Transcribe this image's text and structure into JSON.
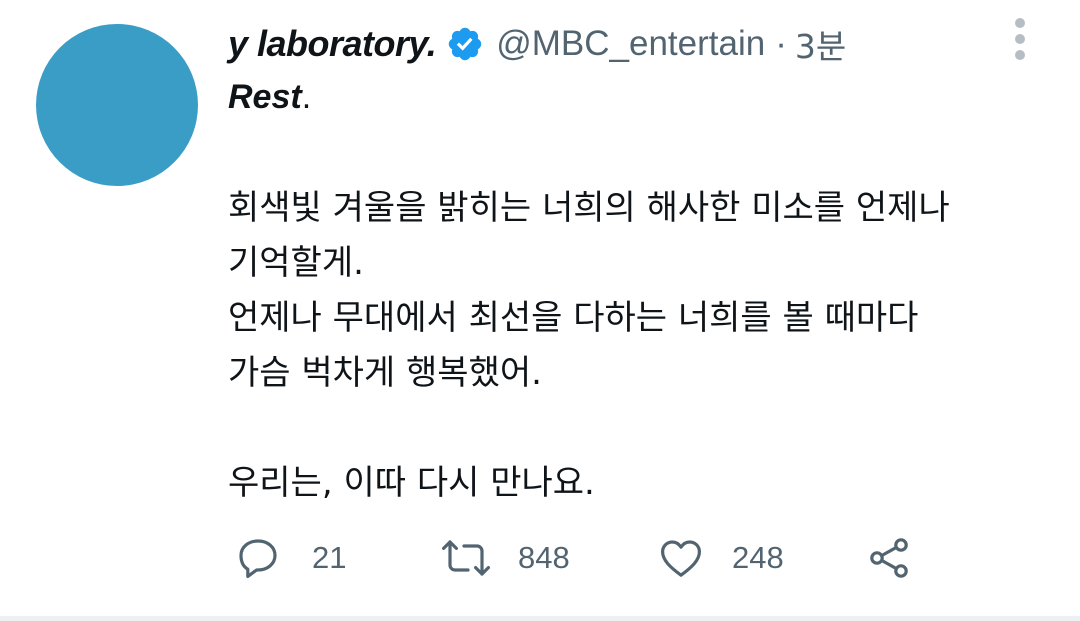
{
  "tweet": {
    "author": {
      "display_name": "y laboratory.",
      "handle": "@MBC_entertain",
      "verified": true,
      "avatar_color": "#3a9dc5"
    },
    "separator": "·",
    "time_ago": "3분",
    "title": {
      "bold": "Rest",
      "suffix": "."
    },
    "lines": [
      "회색빛 겨울을 밝히는 너희의 해사한 미소를 언제나",
      "기억할게.",
      "언제나 무대에서 최선을 다하는 너희를 볼 때마다",
      "가슴 벅차게 행복했어.",
      "우리는, 이따 다시 만나요."
    ],
    "actions": {
      "reply_count": "21",
      "retweet_count": "848",
      "like_count": "248"
    },
    "icons": {
      "verified": "verified-badge-icon",
      "more": "more-vertical-icon",
      "reply": "reply-bubble-icon",
      "retweet": "retweet-icon",
      "like": "heart-icon",
      "share": "share-icon"
    },
    "colors": {
      "verified_blue": "#1d9bf0",
      "secondary_text": "#536471",
      "primary_text": "#0f1419"
    }
  }
}
